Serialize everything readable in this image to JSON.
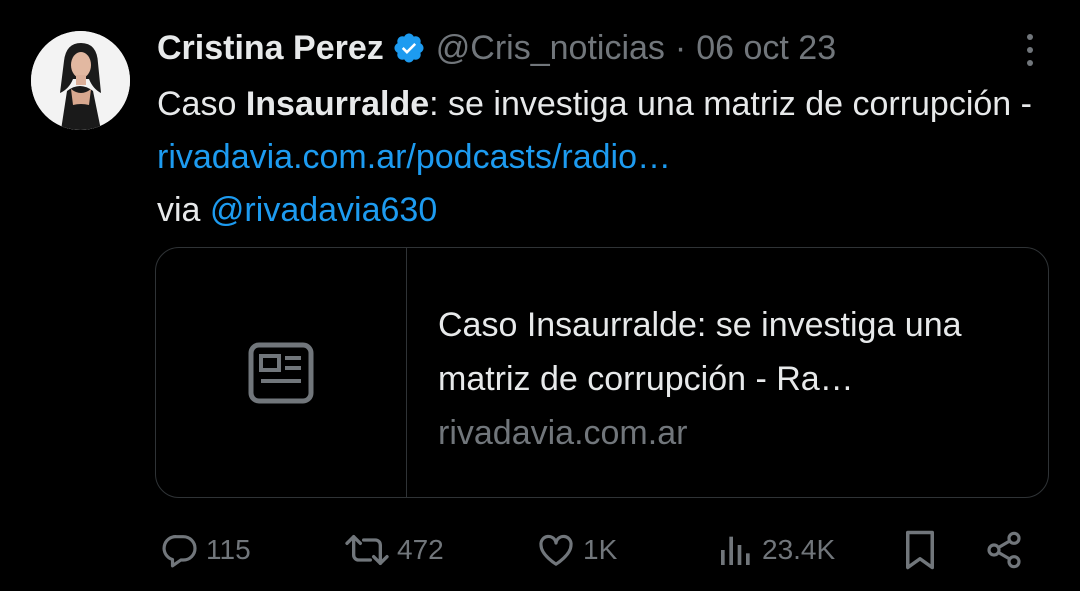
{
  "tweet": {
    "author_name": "Cristina Perez",
    "handle": "@Cris_noticias",
    "separator": "·",
    "date": "06 oct 23",
    "text_prefix": "Caso ",
    "text_bold": "Insaurralde",
    "text_middle": ": se investiga una matriz de corrupción -  ",
    "link_url": "rivadavia.com.ar/podcasts/radio…",
    "text_via": "via ",
    "mention": "@rivadavia630"
  },
  "card": {
    "title": "Caso Insaurralde: se investiga una matriz de corrupción - Ra…",
    "domain": "rivadavia.com.ar"
  },
  "actions": {
    "replies": "115",
    "retweets": "472",
    "likes": "1K",
    "views": "23.4K"
  },
  "colors": {
    "background": "#000000",
    "text": "#e7e9ea",
    "muted": "#71767b",
    "link": "#1d9bf0",
    "border": "#2f3336"
  }
}
